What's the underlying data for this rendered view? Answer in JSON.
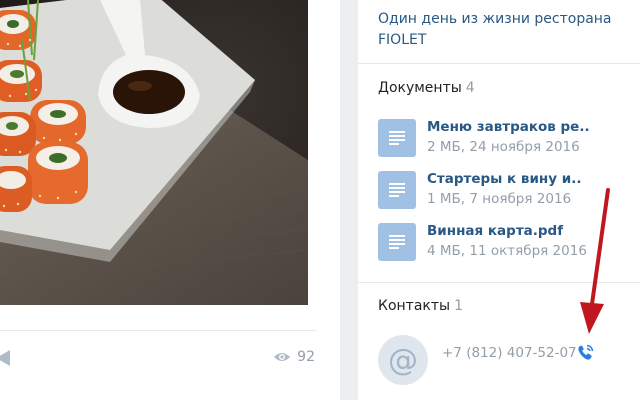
{
  "post": {
    "views": "92",
    "icons": {
      "share": "share-arrow-icon",
      "views": "eye-icon"
    }
  },
  "sidebar": {
    "event_title": "Один день из жизни ресторана FIOLET",
    "documents": {
      "label": "Документы",
      "count": "4",
      "items": [
        {
          "name": "Меню завтраков ре..",
          "meta": "2 МБ, 24 ноября 2016"
        },
        {
          "name": "Стартеры к вину и..",
          "meta": "1 МБ, 7 ноября 2016"
        },
        {
          "name": "Винная карта.pdf",
          "meta": "4 МБ, 11 октября 2016"
        }
      ]
    },
    "contacts": {
      "label": "Контакты",
      "count": "1",
      "avatar_symbol": "@",
      "phone": "+7 (812) 407-52-07"
    }
  },
  "colors": {
    "background": "#edeef0",
    "card": "#ffffff",
    "link": "#2a5885",
    "muted": "#939ea9",
    "doc_icon": "#a1c1e4",
    "accent_blue": "#2a7de1",
    "annotation_red": "#c01620"
  }
}
